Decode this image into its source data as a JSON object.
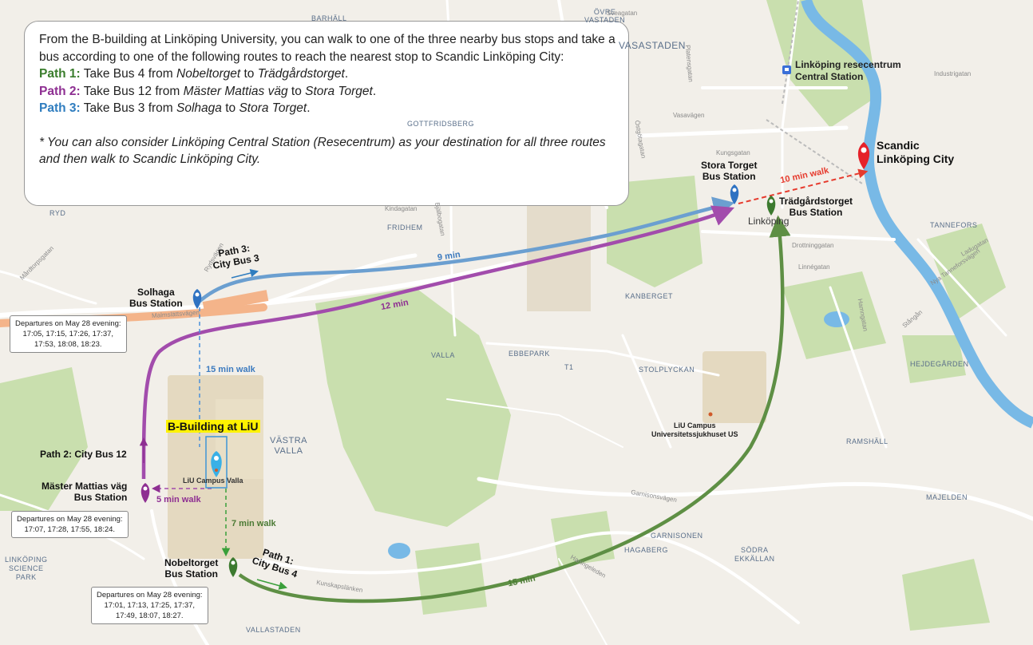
{
  "info": {
    "intro": "From the B-building at Linköping University, you can walk to one of the three nearby bus stops and take a bus according to one of the following routes to reach the nearest stop to Scandic Linköping City:",
    "paths": [
      {
        "label": "Path 1:",
        "pre": " Take Bus 4 from ",
        "from": "Nobeltorget",
        "mid": " to ",
        "to": "Trädgårdstorget",
        "end": "."
      },
      {
        "label": "Path 2:",
        "pre": " Take Bus 12 from ",
        "from": "Mäster Mattias väg",
        "mid": " to ",
        "to": "Stora Torget",
        "end": "."
      },
      {
        "label": "Path 3:",
        "pre": " Take Bus 3 from ",
        "from": "Solhaga",
        "mid": " to ",
        "to": "Stora Torget",
        "end": "."
      }
    ],
    "note": "* You can also consider Linköping Central Station (Resecentrum) as your destination for all three routes and then walk to Scandic Linköping City."
  },
  "places": {
    "hotel": "Scandic\nLinköping City",
    "central": "Linköping resecentrum\nCentral Station",
    "stora_torget": "Stora Torget\nBus Station",
    "tradgard": "Trädgårdstorget\nBus Station",
    "linkoping": "Linköping",
    "solhaga": "Solhaga\nBus Station",
    "mattias": "Mäster Mattias väg\nBus Station",
    "nobel": "Nobeltorget\nBus Station",
    "bbuilding": "B-Building at LiU",
    "campus_valla": "LiU Campus Valla",
    "campus_us": "LiU Campus\nUniversitetssjukhuset US"
  },
  "routes": {
    "path3_label": "Path 3:\nCity Bus 3",
    "path2_label": "Path 2: City Bus 12",
    "path1_label": "Path 1:\nCity Bus 4",
    "t9": "9 min",
    "t12": "12 min",
    "t15": "15 min",
    "walk10": "10 min walk",
    "walk15": "15 min walk",
    "walk5": "5 min walk",
    "walk7": "7 min walk"
  },
  "departures": {
    "solhaga": "Departures on May 28 evening:\n17:05, 17:15, 17:26, 17:37,\n17:53, 18:08, 18:23.",
    "mattias": "Departures on May 28 evening:\n17:07, 17:28, 17:55, 18:24.",
    "nobel": "Departures on May 28 evening:\n17:01, 17:13, 17:25, 17:37,\n17:49, 18:07, 18:27."
  },
  "areas": [
    "BARHÄLL",
    "ÖVRE\nVASTADEN",
    "VASASTADEN",
    "GOTTFRIDSBERG",
    "RYD",
    "FRIDHEM",
    "KANBERGET",
    "VALLA",
    "EBBEPARK",
    "T1",
    "STOLPLYCKAN",
    "HEJDEGÅRDEN",
    "TANNEFORS",
    "RAMSHÄLL",
    "VÄSTRA\nVALLA",
    "MAJELDEN",
    "GARNISONEN",
    "HAGABERG",
    "SÖDRA\nEKKÄLLAN",
    "LINKÖPING\nSCIENCE\nPARK",
    "VALLASTADEN"
  ],
  "streets": [
    "Kungsgatan",
    "Drottninggatan",
    "Vasavägen",
    "Kindagatan",
    "Malmslättsvägen",
    "Garnisonsvägen",
    "Haningeleden",
    "Kunskapslänken",
    "Linnégatan",
    "Östgötagatan",
    "Sveagatan",
    "Platensgatan",
    "Bjälbogatan",
    "Industrigatan",
    "Ladugatan",
    "Nya Tanneforsvägen",
    "Stångån",
    "Hamngatan",
    "Rydsvägen",
    "Mårdtorpsgatan"
  ],
  "colors": {
    "path1": "#5e8f44",
    "path2": "#a24cac",
    "path3": "#6b9fd0",
    "walk_red": "#e63b2e",
    "water": "#78b9e6",
    "park": "#c9dfae"
  },
  "icons": [
    "bus-station-pin",
    "hotel-pin",
    "train-station-icon",
    "walk-arrow"
  ]
}
